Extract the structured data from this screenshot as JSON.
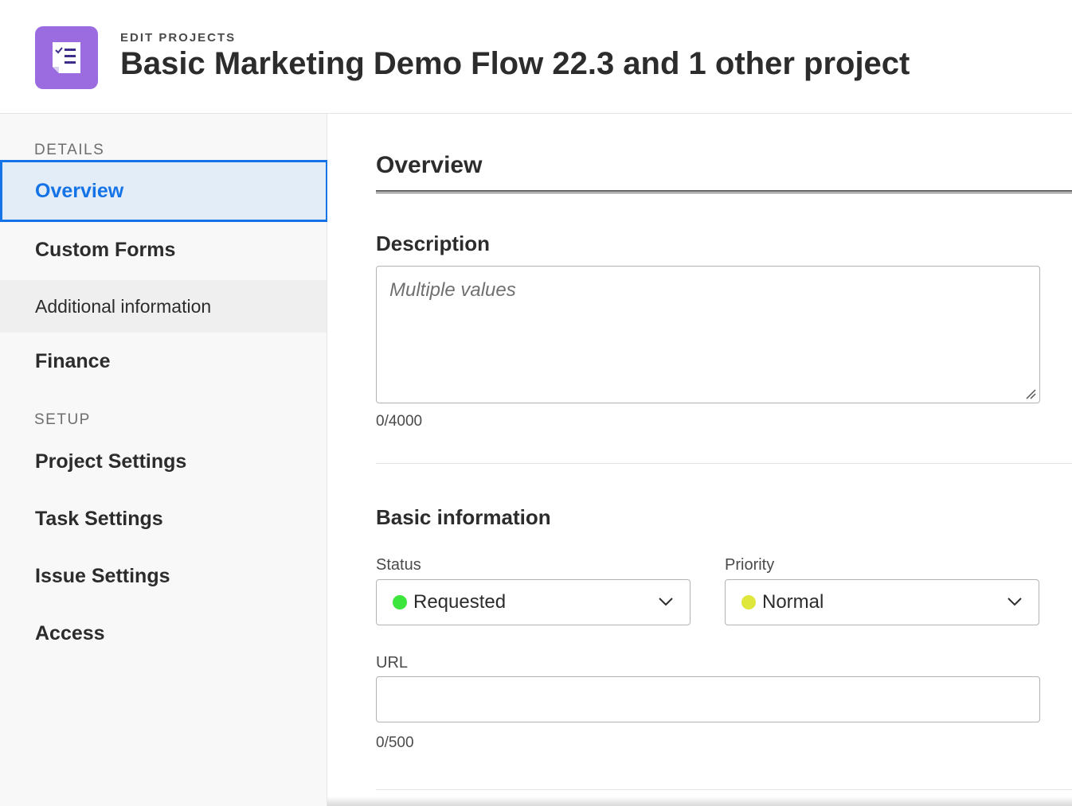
{
  "header": {
    "eyebrow": "EDIT PROJECTS",
    "title": "Basic Marketing Demo Flow 22.3 and 1 other project",
    "icon": "checklist-icon",
    "icon_color": "#9b6ce0"
  },
  "sidebar": {
    "details_label": "DETAILS",
    "setup_label": "SETUP",
    "items": [
      {
        "label": "Overview",
        "active": true
      },
      {
        "label": "Custom Forms"
      },
      {
        "label": "Additional information"
      },
      {
        "label": "Finance"
      },
      {
        "label": "Project Settings"
      },
      {
        "label": "Task Settings"
      },
      {
        "label": "Issue Settings"
      },
      {
        "label": "Access"
      }
    ],
    "accent_color": "#1473e6"
  },
  "main": {
    "section_title": "Overview",
    "description": {
      "heading": "Description",
      "placeholder": "Multiple values",
      "counter": "0/4000"
    },
    "basic_info": {
      "heading": "Basic information",
      "status": {
        "label": "Status",
        "value": "Requested",
        "dot_color": "#3ce63c"
      },
      "priority": {
        "label": "Priority",
        "value": "Normal",
        "dot_color": "#dfe63c"
      },
      "url": {
        "label": "URL",
        "value": "",
        "counter": "0/500"
      }
    }
  }
}
